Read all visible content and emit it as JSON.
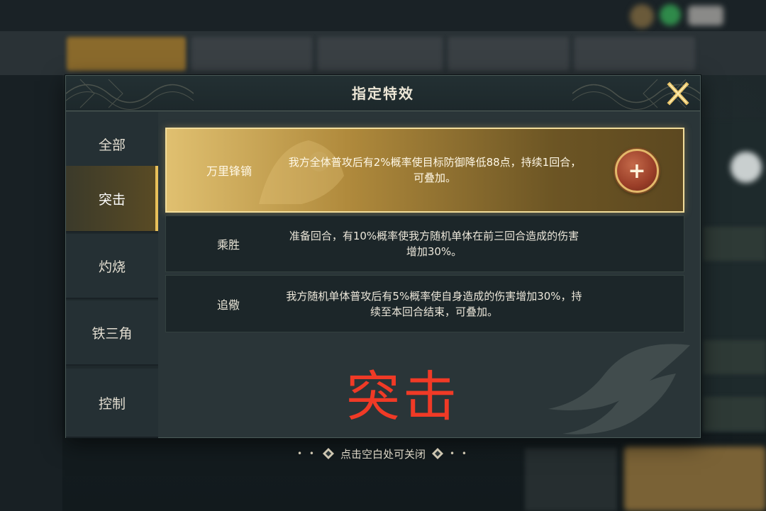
{
  "dialog": {
    "title": "指定特效",
    "close_label": "X"
  },
  "categories": [
    {
      "label": "全部",
      "active": false
    },
    {
      "label": "突击",
      "active": true
    },
    {
      "label": "灼烧",
      "active": false
    },
    {
      "label": "铁三角",
      "active": false
    },
    {
      "label": "控制",
      "active": false
    }
  ],
  "effects": [
    {
      "name": "万里锋镝",
      "description": "我方全体普攻后有2%概率使目标防御降低88点，持续1回合，可叠加。",
      "selected": true,
      "add_label": "+"
    },
    {
      "name": "乘胜",
      "description": "准备回合，有10%概率使我方随机单体在前三回合造成的伤害增加30%。",
      "selected": false
    },
    {
      "name": "追儆",
      "description": "我方随机单体普攻后有5%概率使自身造成的伤害增加30%，持续至本回合结束，可叠加。",
      "selected": false
    }
  ],
  "overlay_label": "突击",
  "hint": {
    "text": "点击空白处可关闭",
    "left_ornament": "• •",
    "right_ornament": "• •"
  },
  "colors": {
    "accent_gold": "#e8c05a",
    "overlay_red": "#f03a26",
    "add_button_red": "#9a3e28"
  }
}
